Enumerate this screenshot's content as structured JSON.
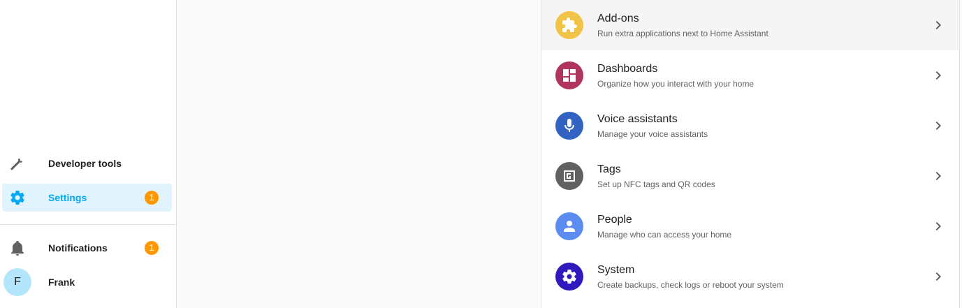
{
  "sidebar": {
    "items": [
      {
        "label": "Developer tools",
        "icon": "hammer-icon"
      },
      {
        "label": "Settings",
        "icon": "gear-icon",
        "badge": "1",
        "active": true
      }
    ],
    "notifications": {
      "label": "Notifications",
      "icon": "bell-icon",
      "badge": "1"
    },
    "user": {
      "initial": "F",
      "name": "Frank"
    }
  },
  "colors": {
    "accent": "#03a9f4",
    "badge": "#ff9800",
    "addons": "#f1c447",
    "dashboards": "#b1345c",
    "voice": "#3263c3",
    "tags": "#616161",
    "people": "#5c8cf1",
    "system": "#301abe"
  },
  "settings_list": [
    {
      "title": "Add-ons",
      "subtitle": "Run extra applications next to Home Assistant",
      "icon": "puzzle-icon"
    },
    {
      "title": "Dashboards",
      "subtitle": "Organize how you interact with your home",
      "icon": "dashboard-icon"
    },
    {
      "title": "Voice assistants",
      "subtitle": "Manage your voice assistants",
      "icon": "microphone-icon"
    },
    {
      "title": "Tags",
      "subtitle": "Set up NFC tags and QR codes",
      "icon": "nfc-tag-icon"
    },
    {
      "title": "People",
      "subtitle": "Manage who can access your home",
      "icon": "person-icon"
    },
    {
      "title": "System",
      "subtitle": "Create backups, check logs or reboot your system",
      "icon": "gear-icon"
    }
  ]
}
